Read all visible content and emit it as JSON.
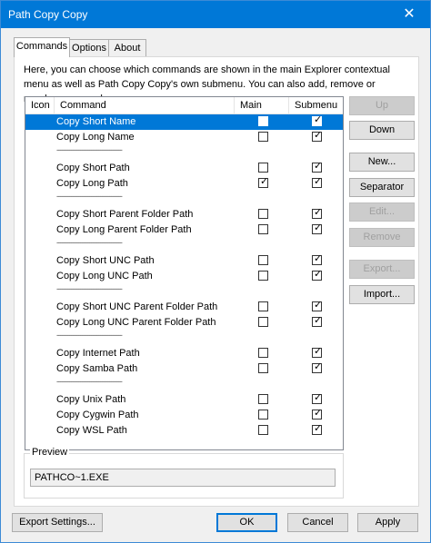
{
  "window": {
    "title": "Path Copy Copy",
    "close_glyph": "✕"
  },
  "tabs": [
    {
      "label": "Commands",
      "active": true
    },
    {
      "label": "Options",
      "active": false
    },
    {
      "label": "About",
      "active": false
    }
  ],
  "description": "Here, you can choose which commands are shown in the main Explorer contextual menu as well as Path Copy Copy's own submenu. You can also add, remove or reorder commands.",
  "columns": {
    "icon": "Icon",
    "command": "Command",
    "main_menu": "Main menu",
    "submenu": "Submenu"
  },
  "separator_text": "------------------------------------",
  "rows": [
    {
      "type": "cmd",
      "name": "Copy Short Name",
      "main": false,
      "sub": true,
      "selected": true
    },
    {
      "type": "cmd",
      "name": "Copy Long Name",
      "main": false,
      "sub": true
    },
    {
      "type": "sep"
    },
    {
      "type": "cmd",
      "name": "Copy Short Path",
      "main": false,
      "sub": true
    },
    {
      "type": "cmd",
      "name": "Copy Long Path",
      "main": true,
      "sub": true
    },
    {
      "type": "sep"
    },
    {
      "type": "cmd",
      "name": "Copy Short Parent Folder Path",
      "main": false,
      "sub": true
    },
    {
      "type": "cmd",
      "name": "Copy Long Parent Folder Path",
      "main": false,
      "sub": true
    },
    {
      "type": "sep"
    },
    {
      "type": "cmd",
      "name": "Copy Short UNC Path",
      "main": false,
      "sub": true
    },
    {
      "type": "cmd",
      "name": "Copy Long UNC Path",
      "main": false,
      "sub": true
    },
    {
      "type": "sep"
    },
    {
      "type": "cmd",
      "name": "Copy Short UNC Parent Folder Path",
      "main": false,
      "sub": true
    },
    {
      "type": "cmd",
      "name": "Copy Long UNC Parent Folder Path",
      "main": false,
      "sub": true
    },
    {
      "type": "sep"
    },
    {
      "type": "cmd",
      "name": "Copy Internet Path",
      "main": false,
      "sub": true
    },
    {
      "type": "cmd",
      "name": "Copy Samba Path",
      "main": false,
      "sub": true
    },
    {
      "type": "sep"
    },
    {
      "type": "cmd",
      "name": "Copy Unix Path",
      "main": false,
      "sub": true
    },
    {
      "type": "cmd",
      "name": "Copy Cygwin Path",
      "main": false,
      "sub": true
    },
    {
      "type": "cmd",
      "name": "Copy WSL Path",
      "main": false,
      "sub": true
    }
  ],
  "side_buttons": {
    "up": "Up",
    "down": "Down",
    "new": "New...",
    "separator": "Separator",
    "edit": "Edit...",
    "remove": "Remove",
    "export": "Export...",
    "import": "Import..."
  },
  "preview": {
    "label": "Preview",
    "value": "PATHCO~1.EXE"
  },
  "footer": {
    "export_settings": "Export Settings...",
    "ok": "OK",
    "cancel": "Cancel",
    "apply": "Apply"
  },
  "checkmark_glyph": "✓"
}
